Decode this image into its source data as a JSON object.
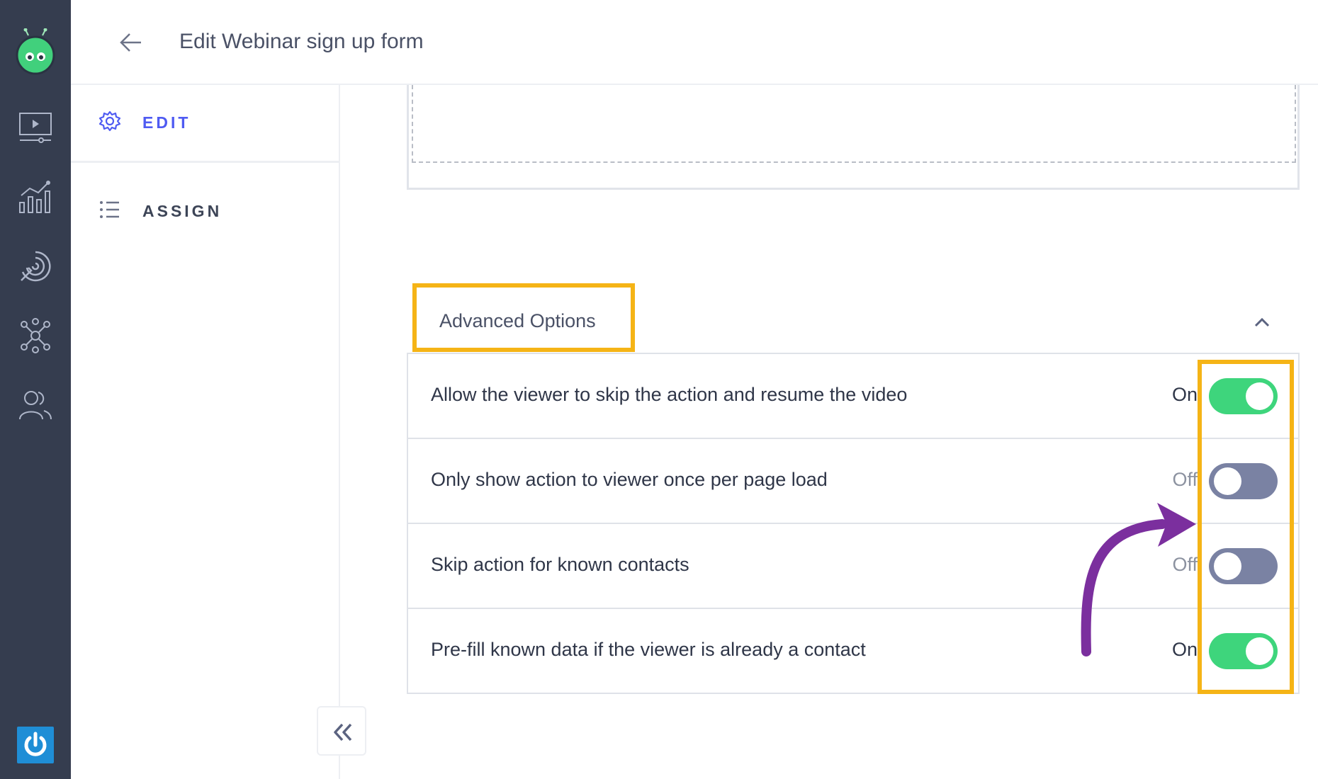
{
  "header": {
    "title": "Edit Webinar sign up form"
  },
  "subnav": {
    "items": [
      {
        "label": "EDIT",
        "icon": "gear-icon",
        "active": true
      },
      {
        "label": "ASSIGN",
        "icon": "list-icon",
        "active": false
      }
    ]
  },
  "rail": {
    "icons": [
      "robot-logo-icon",
      "video-player-icon",
      "analytics-chart-icon",
      "target-fingerprint-icon",
      "integrations-network-icon",
      "contacts-people-icon",
      "power-icon"
    ]
  },
  "advanced_options": {
    "title": "Advanced Options",
    "rows": [
      {
        "label": "Allow the viewer to skip the action and resume the video",
        "state_label": "On",
        "enabled": true
      },
      {
        "label": "Only show action to viewer once per page load",
        "state_label": "Off",
        "enabled": false
      },
      {
        "label": "Skip action for known contacts",
        "state_label": "Off",
        "enabled": false
      },
      {
        "label": "Pre-fill known data if the viewer is already a contact",
        "state_label": "On",
        "enabled": true
      }
    ]
  },
  "colors": {
    "rail_bg": "#353d4f",
    "accent": "#4f5bf2",
    "toggle_on": "#3ed57c",
    "toggle_off": "#7a82a3",
    "highlight": "#f5b416",
    "annotation_arrow": "#7b2f9e"
  }
}
